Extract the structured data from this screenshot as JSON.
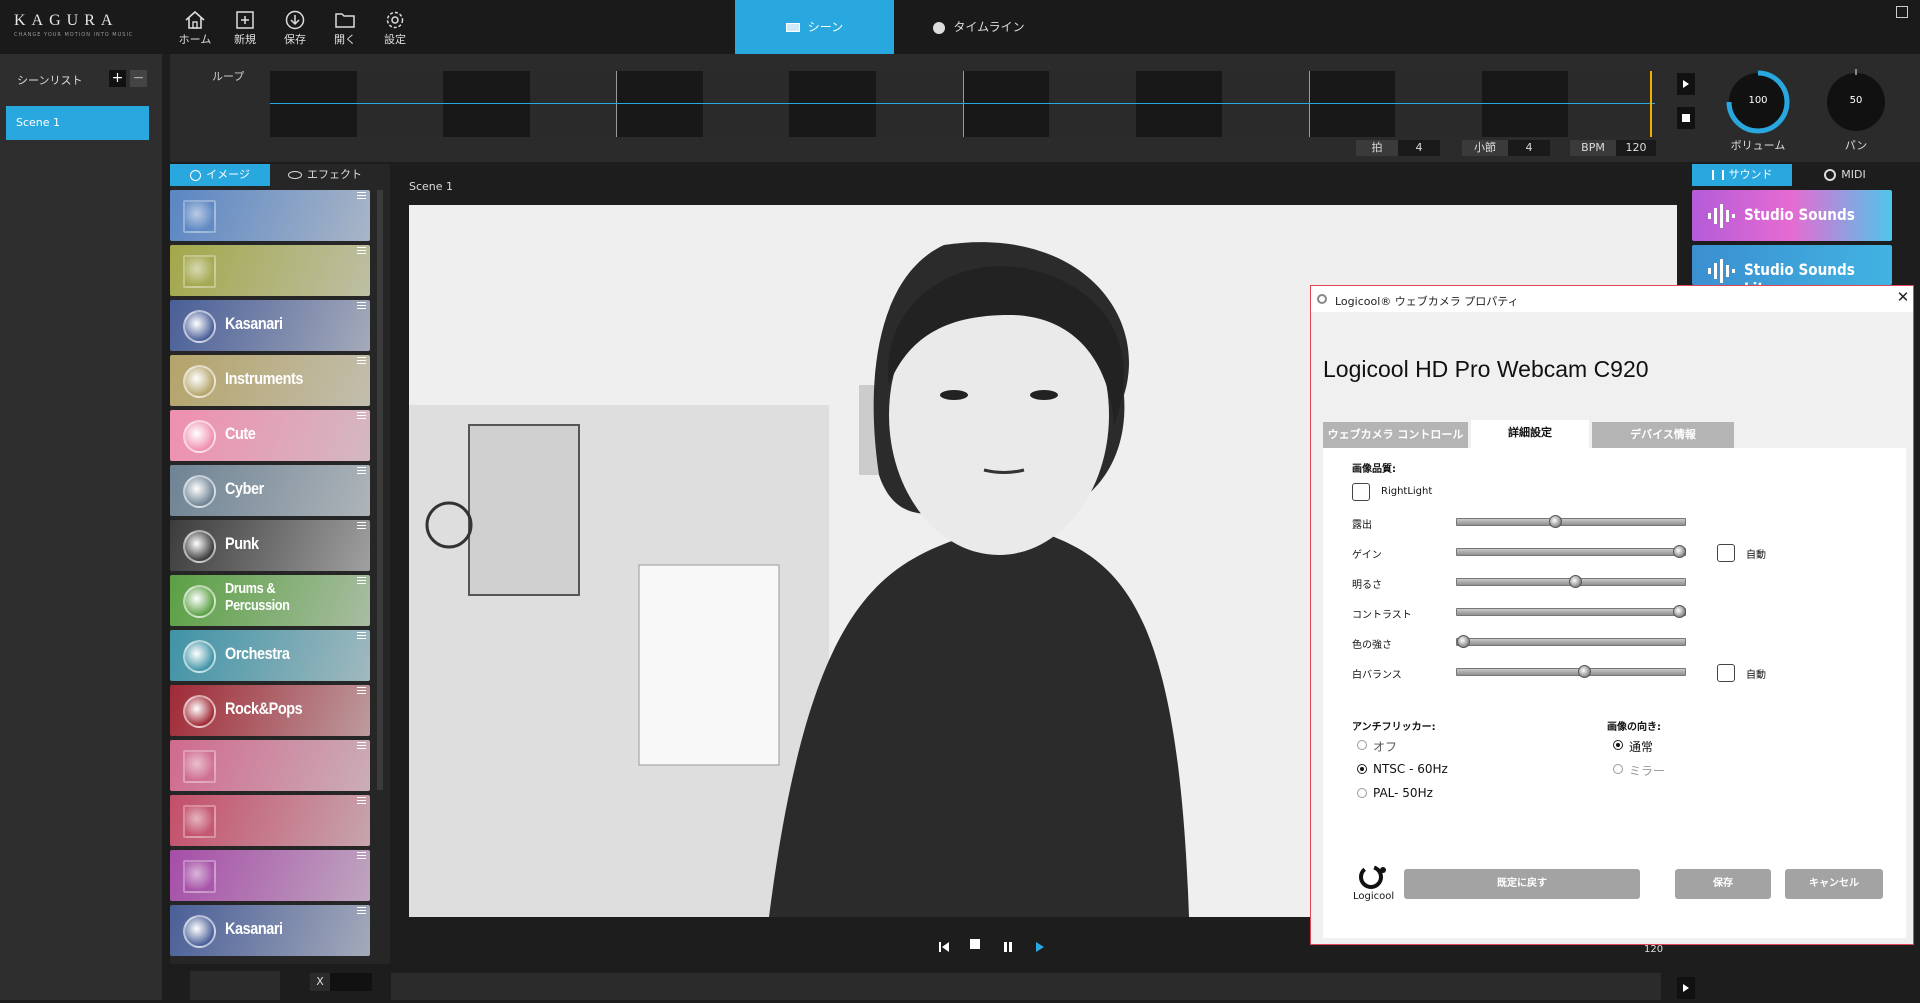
{
  "app": {
    "logo": "KAGURA",
    "tagline": "CHANGE YOUR MOTION INTO MUSIC"
  },
  "toolbar": {
    "home": "ホーム",
    "new": "新規",
    "save": "保存",
    "open": "開く",
    "settings": "設定"
  },
  "tabs": {
    "scene": "シーン",
    "timeline": "タイムライン"
  },
  "scene_list": {
    "title": "シーンリスト",
    "add": "+",
    "remove": "−",
    "items": [
      {
        "label": "Scene   1"
      }
    ]
  },
  "loop": {
    "label": "ループ",
    "beat_label": "拍",
    "beat": "4",
    "bar_label": "小節",
    "bar": "4",
    "bpm_label": "BPM",
    "bpm": "120"
  },
  "volume": {
    "value": "100",
    "label": "ボリューム",
    "level": 100
  },
  "pan": {
    "value": "50",
    "label": "パン"
  },
  "left_tabs": {
    "image": "イメージ",
    "effect": "エフェクト"
  },
  "packs": [
    {
      "name": "",
      "color": "#5a86c4"
    },
    {
      "name": "",
      "color": "#a3a84a"
    },
    {
      "name": "Kasanari",
      "color": "#4a5f98"
    },
    {
      "name": "Instruments",
      "color": "#b4a46a"
    },
    {
      "name": "Cute",
      "color": "#ef8fb0"
    },
    {
      "name": "Cyber",
      "color": "#6e8394"
    },
    {
      "name": "Punk",
      "color": "#3c3c3c"
    },
    {
      "name": "Drums &\nPercussion",
      "color": "#5aa043"
    },
    {
      "name": "Orchestra",
      "color": "#3f93a6"
    },
    {
      "name": "Rock&Pops",
      "color": "#a02a36"
    },
    {
      "name": "",
      "color": "#d06a8e"
    },
    {
      "name": "",
      "color": "#c44e6a"
    },
    {
      "name": "",
      "color": "#a64ea8"
    },
    {
      "name": "Kasanari",
      "color": "#4a5f98"
    }
  ],
  "stage": {
    "scene_label": "Scene   1"
  },
  "right_tabs": {
    "sound": "サウンド",
    "midi": "MIDI"
  },
  "sounds": [
    {
      "name": "Studio Sounds"
    },
    {
      "name": "Studio Sounds Lite"
    }
  ],
  "dialog": {
    "title": "Logicool® ウェブカメラ プロパティ",
    "heading": "Logicool HD Pro Webcam C920",
    "tabs": [
      "ウェブカメラ コントロール",
      "詳細設定",
      "デバイス情報"
    ],
    "quality_label": "画像品質:",
    "rightlight": "RightLight",
    "sliders": [
      {
        "label": "露出",
        "value": 0.43,
        "auto": false
      },
      {
        "label": "ゲイン",
        "value": 0.98,
        "auto": true
      },
      {
        "label": "明るさ",
        "value": 0.52,
        "auto": false
      },
      {
        "label": "コントラスト",
        "value": 0.98,
        "auto": false
      },
      {
        "label": "色の強さ",
        "value": 0.02,
        "auto": false
      },
      {
        "label": "白バランス",
        "value": 0.56,
        "auto": true
      }
    ],
    "auto_label": "自動",
    "antiflicker_label": "アンチフリッカー:",
    "antiflicker": [
      "オフ",
      "NTSC - 60Hz",
      "PAL- 50Hz"
    ],
    "antiflicker_selected": 1,
    "orientation_label": "画像の向き:",
    "orientation": [
      "通常",
      "ミラー"
    ],
    "orientation_selected": 0,
    "brand": "Logicool",
    "btn_default": "既定に戻す",
    "btn_save": "保存",
    "btn_cancel": "キャンセル"
  },
  "transport": {
    "bpm_small": "120"
  },
  "bottom": {
    "x_label": "X"
  },
  "colors": {
    "accent": "#29a8e0"
  }
}
